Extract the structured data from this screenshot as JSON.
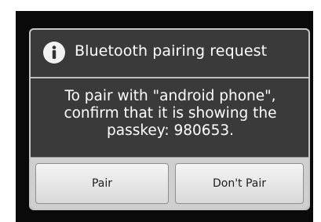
{
  "dialog": {
    "title": "Bluetooth pairing request",
    "icon": "info-icon",
    "message_lines": [
      "To pair with \"android phone\",",
      "confirm that it is showing the",
      "passkey: 980653."
    ],
    "buttons": {
      "pair_label": "Pair",
      "dont_pair_label": "Don't Pair"
    }
  },
  "colors": {
    "dialog_background": "#3a3a3a",
    "screen_background": "#0a0a0a",
    "button_bar": "#cfcfcf",
    "text_light": "#ffffff"
  }
}
